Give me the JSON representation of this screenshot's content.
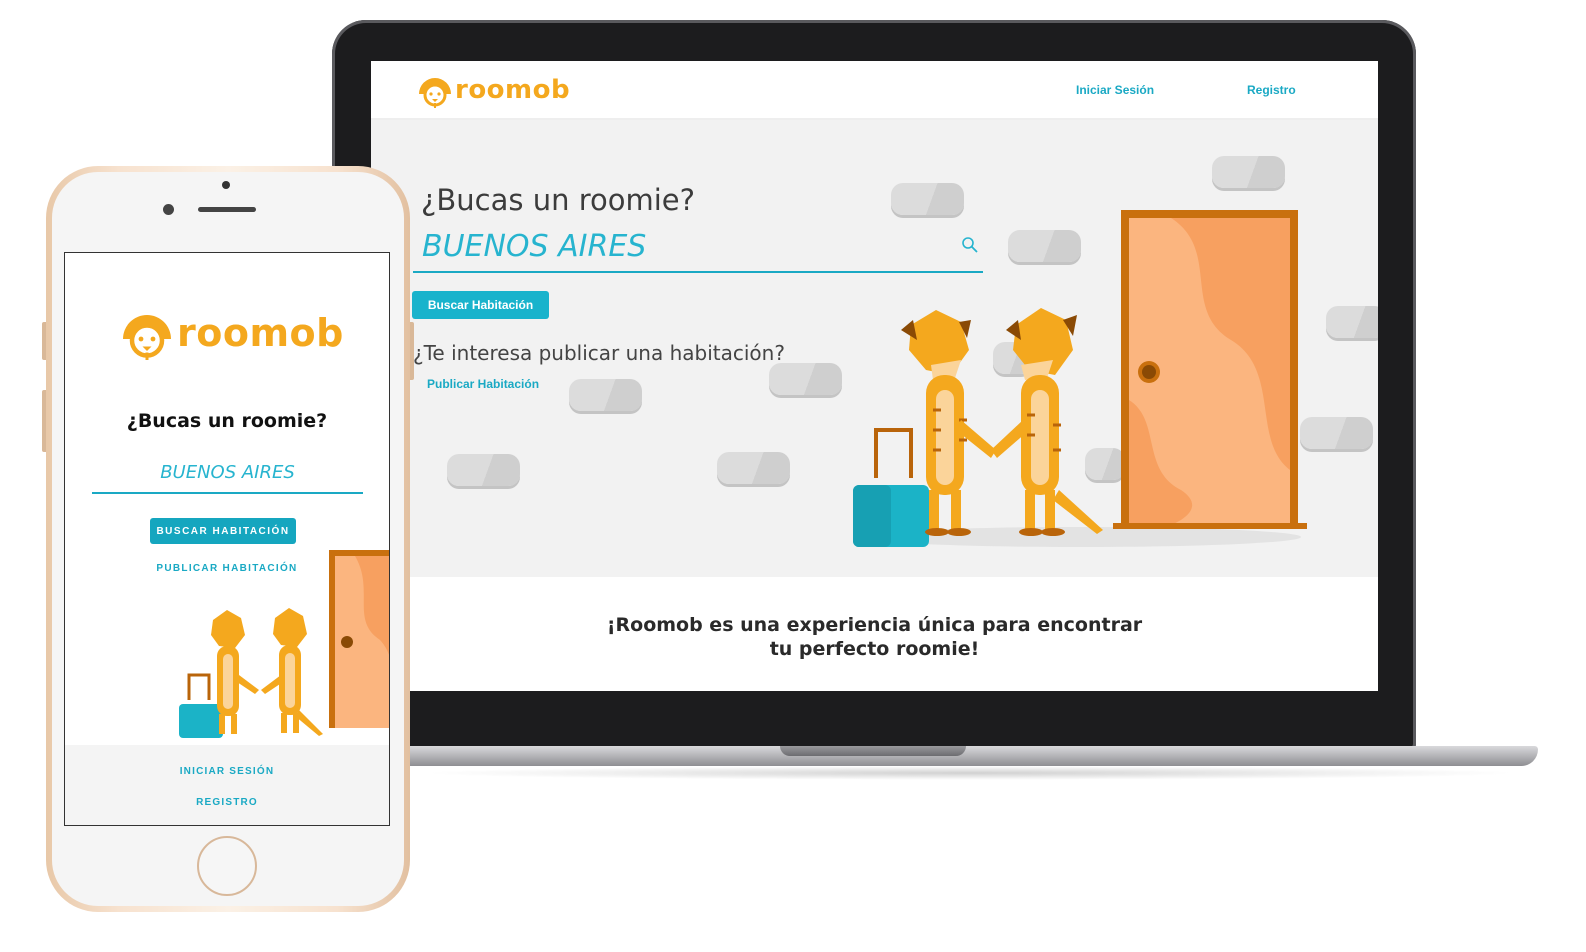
{
  "brand": {
    "name": "roomob",
    "primary_color": "#f4a81e",
    "accent_color": "#1aa9c4"
  },
  "desktop": {
    "nav": {
      "login": "Iniciar Sesión",
      "register": "Registro"
    },
    "hero": {
      "title": "¿Bucas un roomie?",
      "search_value": "BUENOS AIRES",
      "search_button": "Buscar Habitación",
      "publish_question": "¿Te interesa publicar una habitación?",
      "publish_link": "Publicar Habitación"
    },
    "tagline": {
      "line1": "¡Roomob es una experiencia única para encontrar",
      "line2": "tu perfecto roomie!"
    }
  },
  "mobile": {
    "title": "¿Bucas un roomie?",
    "search_value": "BUENOS AIRES",
    "search_button": "BUSCAR HABITACIÓN",
    "publish_link": "PUBLICAR HABITACIÓN",
    "footer": {
      "login": "INICIAR SESIÓN",
      "register": "REGISTRO"
    }
  },
  "icons": {
    "search": "search-icon",
    "logo": "meerkat-logo-icon"
  }
}
